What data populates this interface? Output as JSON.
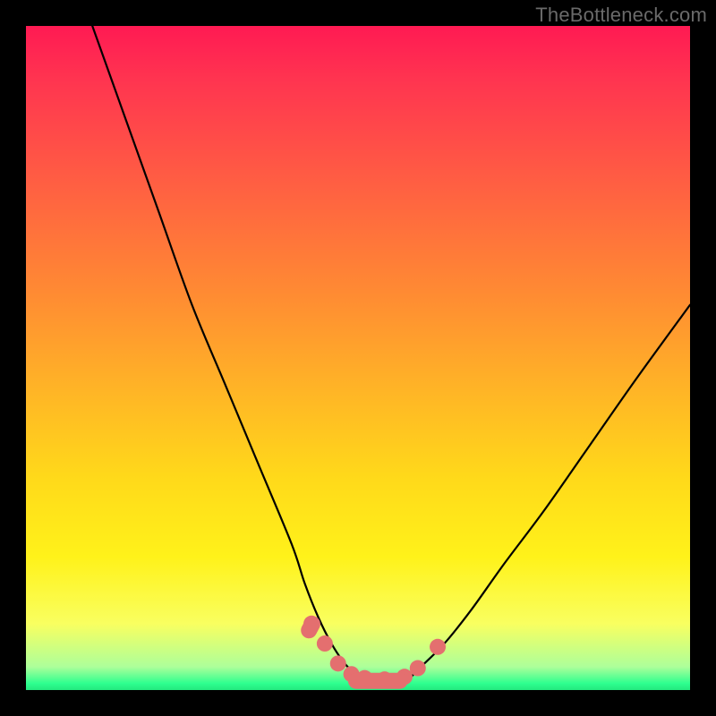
{
  "watermark": "TheBottleneck.com",
  "chart_data": {
    "type": "line",
    "title": "",
    "xlabel": "",
    "ylabel": "",
    "xlim": [
      0,
      100
    ],
    "ylim": [
      0,
      100
    ],
    "series": [
      {
        "name": "left-curve",
        "x": [
          10,
          15,
          20,
          25,
          30,
          35,
          40,
          42,
          44,
          46,
          48,
          50
        ],
        "y": [
          100,
          86,
          72,
          58,
          46,
          34,
          22,
          16,
          11,
          7,
          4,
          2
        ]
      },
      {
        "name": "right-curve",
        "x": [
          58,
          60,
          63,
          67,
          72,
          78,
          85,
          92,
          100
        ],
        "y": [
          2,
          4,
          7,
          12,
          19,
          27,
          37,
          47,
          58
        ]
      },
      {
        "name": "bottom-flat",
        "x": [
          50,
          52,
          55,
          58
        ],
        "y": [
          2,
          1.5,
          1.5,
          2
        ]
      }
    ],
    "markers": [
      {
        "name": "m1",
        "x": 43,
        "y": 10
      },
      {
        "name": "m2",
        "x": 45,
        "y": 7
      },
      {
        "name": "m3",
        "x": 47,
        "y": 4
      },
      {
        "name": "m4",
        "x": 49,
        "y": 2.4
      },
      {
        "name": "m5",
        "x": 51,
        "y": 1.8
      },
      {
        "name": "m6",
        "x": 54,
        "y": 1.6
      },
      {
        "name": "m7",
        "x": 57,
        "y": 2.0
      },
      {
        "name": "m8",
        "x": 59,
        "y": 3.3
      },
      {
        "name": "m9",
        "x": 62,
        "y": 6.5
      }
    ],
    "marker_color": "#e46f6f",
    "curve_color": "#000000"
  }
}
